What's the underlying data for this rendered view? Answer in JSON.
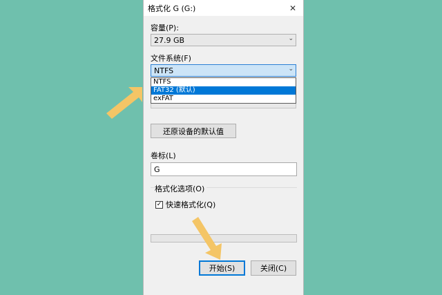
{
  "dialog": {
    "title": "格式化 G (G:)",
    "close_glyph": "✕"
  },
  "capacity": {
    "label": "容量(P):",
    "value": "27.9 GB"
  },
  "filesystem": {
    "label": "文件系统(F)",
    "value": "NTFS",
    "options": [
      {
        "label": "NTFS",
        "selected": false
      },
      {
        "label": "FAT32 (默认)",
        "selected": true
      },
      {
        "label": "exFAT",
        "selected": false
      }
    ]
  },
  "restore_defaults": {
    "label": "还原设备的默认值"
  },
  "volume_label": {
    "label": "卷标(L)",
    "value": "G"
  },
  "format_options": {
    "label": "格式化选项(O)",
    "quick_format": {
      "label": "快速格式化(Q)",
      "checked": true,
      "check_glyph": "✓"
    }
  },
  "progress": {
    "fraction": 0
  },
  "buttons": {
    "start": "开始(S)",
    "close": "关闭(C)"
  },
  "colors": {
    "background": "#6fc0ad",
    "selection": "#0078d7",
    "annotation_arrow": "#f4c566"
  },
  "icons": {
    "dropdown_arrow": "⌄",
    "close": "close-icon",
    "annotation": "arrow-annotation-icon"
  }
}
